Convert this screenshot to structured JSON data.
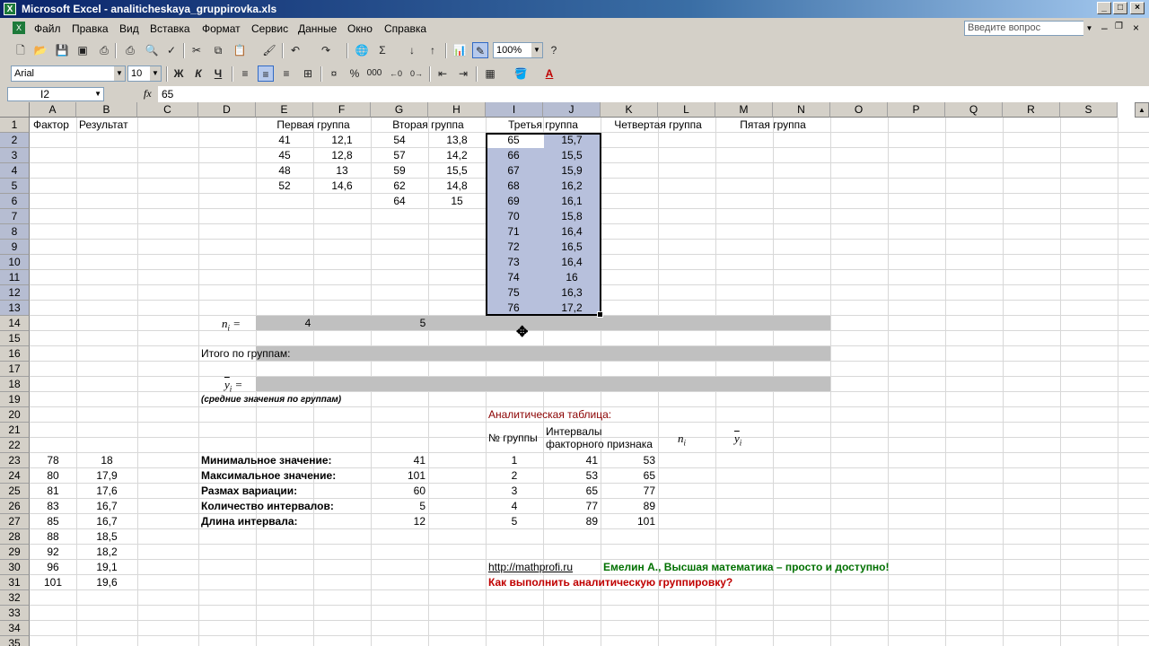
{
  "window": {
    "title": "Microsoft Excel - analiticheskaya_gruppirovka.xls",
    "app_icon": "X"
  },
  "menu": [
    "Файл",
    "Правка",
    "Вид",
    "Вставка",
    "Формат",
    "Сервис",
    "Данные",
    "Окно",
    "Справка"
  ],
  "help_box": {
    "placeholder": "Введите вопрос"
  },
  "toolbar": {
    "zoom": "100%",
    "font": "Arial",
    "font_size": "10",
    "bold": "Ж",
    "italic": "К",
    "underline": "Ч",
    "percent": "%",
    "thousands": "000"
  },
  "formula_bar": {
    "name_box": "I2",
    "fx": "fx",
    "content": "65"
  },
  "columns": [
    "A",
    "B",
    "C",
    "D",
    "E",
    "F",
    "G",
    "H",
    "I",
    "J",
    "K",
    "L",
    "M",
    "N",
    "O",
    "P",
    "Q",
    "R",
    "S"
  ],
  "rows": [
    "1",
    "2",
    "3",
    "4",
    "5",
    "6",
    "7",
    "8",
    "9",
    "10",
    "11",
    "12",
    "13",
    "14",
    "15",
    "16",
    "17",
    "18",
    "19",
    "20",
    "21",
    "22",
    "23",
    "24",
    "25",
    "26",
    "27",
    "28",
    "29",
    "30",
    "31",
    "32",
    "33",
    "34",
    "35"
  ],
  "headers": {
    "factor": "Фактор",
    "result": "Результат",
    "g1": "Первая группа",
    "g2": "Вторая группа",
    "g3": "Третья группа",
    "g4": "Четвертая группа",
    "g5": "Пятая группа"
  },
  "group1": {
    "x": [
      "41",
      "45",
      "48",
      "52"
    ],
    "y": [
      "12,1",
      "12,8",
      "13",
      "14,6"
    ]
  },
  "group2": {
    "x": [
      "54",
      "57",
      "59",
      "62",
      "64"
    ],
    "y": [
      "13,8",
      "14,2",
      "15,5",
      "14,8",
      "15"
    ]
  },
  "group3": {
    "x": [
      "65",
      "66",
      "67",
      "68",
      "69",
      "70",
      "71",
      "72",
      "73",
      "74",
      "75",
      "76"
    ],
    "y": [
      "15,7",
      "15,5",
      "15,9",
      "16,2",
      "16,1",
      "15,8",
      "16,4",
      "16,5",
      "16,4",
      "16",
      "16,3",
      "17,2"
    ]
  },
  "ni": {
    "label_n": "n",
    "label_sub": "i",
    "label_eq": " =",
    "g1": "4",
    "g2": "5"
  },
  "totals_label": "Итого по группам:",
  "ybar": {
    "label_y": "y",
    "label_sub": "i",
    "label_eq": " =",
    "note": "(средние значения по группам)"
  },
  "factor_col": [
    "78",
    "80",
    "81",
    "83",
    "85",
    "88",
    "92",
    "96",
    "101"
  ],
  "result_col": [
    "18",
    "17,9",
    "17,6",
    "16,7",
    "16,7",
    "18,5",
    "18,2",
    "19,1",
    "19,6"
  ],
  "stats": [
    {
      "label": "Минимальное значение:",
      "value": "41"
    },
    {
      "label": "Максимальное значение:",
      "value": "101"
    },
    {
      "label": "Размах вариации:",
      "value": "60"
    },
    {
      "label": "Количество интервалов:",
      "value": "5"
    },
    {
      "label": "Длина интервала:",
      "value": "12"
    }
  ],
  "analytic": {
    "title": "Аналитическая таблица:",
    "col_group": "№ группы",
    "col_interval": "Интервалы факторного признака",
    "col_n": "n",
    "col_n_sub": "i",
    "col_y": "y",
    "col_y_sub": "i",
    "rows": [
      {
        "n": "1",
        "from": "41",
        "to": "53"
      },
      {
        "n": "2",
        "from": "53",
        "to": "65"
      },
      {
        "n": "3",
        "from": "65",
        "to": "77"
      },
      {
        "n": "4",
        "from": "77",
        "to": "89"
      },
      {
        "n": "5",
        "from": "89",
        "to": "101"
      }
    ]
  },
  "footer": {
    "url": "http://mathprofi.ru",
    "author": "Емелин А., Высшая математика – просто и доступно!",
    "question": "Как выполнить аналитическую группировку?"
  }
}
